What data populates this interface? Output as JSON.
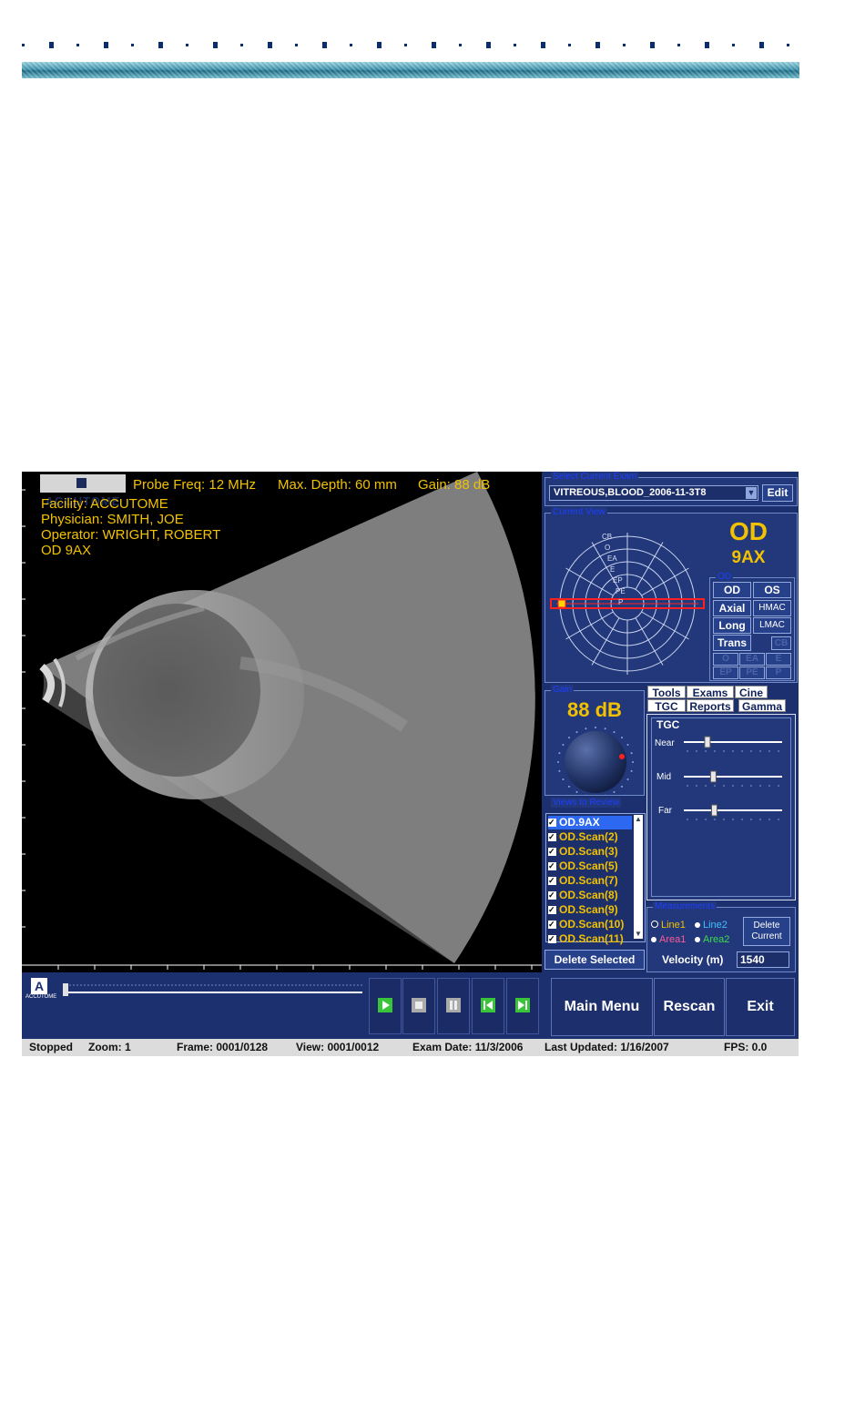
{
  "overlay": {
    "logo": "ACCUTOME",
    "probe_freq": "Probe Freq: 12 MHz",
    "max_depth": "Max. Depth: 60 mm",
    "gain": "Gain: 88 dB",
    "facility": "Facility: ACCUTOME",
    "physician": "Physician: SMITH, JOE",
    "operator": "Operator: WRIGHT, ROBERT",
    "view_label": "OD  9AX"
  },
  "exam_select": {
    "title": "Select Current Exam",
    "value": "VITREOUS,BLOOD_2006-11-3T8",
    "edit_label": "Edit"
  },
  "current_view": {
    "title": "Current View",
    "eye": "OD",
    "view": "9AX",
    "diagram_labels": [
      "CB",
      "O",
      "EA",
      "E",
      "EP",
      "PE",
      "P"
    ],
    "buttons_title": "OD",
    "buttons": {
      "od": "OD",
      "os": "OS",
      "axial": "Axial",
      "hmac": "HMAC",
      "long": "Long",
      "lmac": "LMAC",
      "trans": "Trans",
      "cb": "CB",
      "o": "O",
      "ea": "EA",
      "e": "E",
      "ep": "EP",
      "pe": "PE",
      "p": "P"
    }
  },
  "gain_panel": {
    "title": "Gain",
    "value": "88 dB"
  },
  "tabs": {
    "row1": [
      "Tools",
      "Exams",
      "Cine"
    ],
    "row2": [
      "TGC",
      "Reports",
      "Gamma"
    ]
  },
  "tgc": {
    "title": "TGC",
    "near_label": "Near",
    "mid_label": "Mid",
    "far_label": "Far",
    "near": 0.24,
    "mid": 0.3,
    "far": 0.31
  },
  "views_to_review": {
    "title": "Views to Review",
    "items": [
      "OD.9AX",
      "OD.Scan(2)",
      "OD.Scan(3)",
      "OD.Scan(5)",
      "OD.Scan(7)",
      "OD.Scan(8)",
      "OD.Scan(9)",
      "OD.Scan(10)",
      "OD.Scan(11)"
    ],
    "delete_label": "Delete Selected"
  },
  "measurements": {
    "title": "Measurements",
    "line1": "Line1",
    "line2": "Line2",
    "area1": "Area1",
    "area2": "Area2",
    "delete_current": "Delete Current",
    "velocity_label": "Velocity (m)",
    "velocity_value": "1540"
  },
  "bottom_logo": "ACCUTOME",
  "actions": {
    "main_menu": "Main Menu",
    "rescan": "Rescan",
    "exit": "Exit"
  },
  "status": {
    "state": "Stopped",
    "zoom": "Zoom: 1",
    "frame": "Frame: 0001/0128",
    "view": "View: 0001/0012",
    "exam_date": "Exam Date: 11/3/2006",
    "last_updated": "Last Updated: 1/16/2007",
    "fps": "FPS: 0.0"
  },
  "colors": {
    "panel_bg": "#22387a",
    "overlay_text": "#f2c200",
    "selection": "#2d68f0",
    "header_bar": "#3d93ad"
  }
}
